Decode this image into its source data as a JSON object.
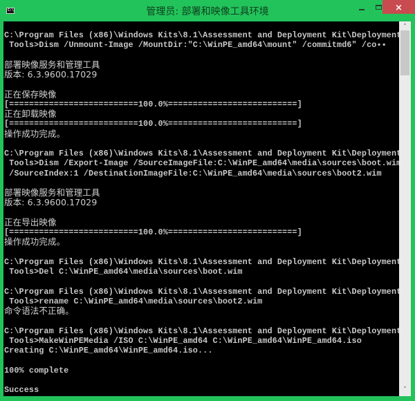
{
  "window": {
    "title": "管理员: 部署和映像工具环境",
    "app_icon_label": "C:\\",
    "controls": {
      "minimize": "minimize",
      "maximize": "maximize",
      "close": "×"
    },
    "accent_color": "#22c35a",
    "close_color": "#c84b4f"
  },
  "scrollbar": {
    "up_arrow": "˄",
    "down_arrow": "˅",
    "position_fraction": 0.0
  },
  "console": {
    "lines": [
      "C:\\Program Files (x86)\\Windows Kits\\8.1\\Assessment and Deployment Kit\\Deployment",
      " Tools>Dism /Unmount-Image /MountDir:\"C:\\WinPE_amd64\\mount\" /commitmd6\" /co▪▪",
      "",
      "部署映像服务和管理工具",
      "版本: 6.3.9600.17029",
      "",
      "正在保存映像",
      "[==========================100.0%==========================]",
      "正在卸载映像",
      "[==========================100.0%==========================]",
      "操作成功完成。",
      "",
      "C:\\Program Files (x86)\\Windows Kits\\8.1\\Assessment and Deployment Kit\\Deployment",
      " Tools>Dism /Export-Image /SourceImageFile:C:\\WinPE_amd64\\media\\sources\\boot.wim",
      " /SourceIndex:1 /DestinationImageFile:C:\\WinPE_amd64\\media\\sources\\boot2.wim",
      "",
      "部署映像服务和管理工具",
      "版本: 6.3.9600.17029",
      "",
      "正在导出映像",
      "[==========================100.0%==========================]",
      "操作成功完成。",
      "",
      "C:\\Program Files (x86)\\Windows Kits\\8.1\\Assessment and Deployment Kit\\Deployment",
      " Tools>Del C:\\WinPE_amd64\\media\\sources\\boot.wim",
      "",
      "C:\\Program Files (x86)\\Windows Kits\\8.1\\Assessment and Deployment Kit\\Deployment",
      " Tools>rename C:\\WinPE_amd64\\media\\sources\\boot2.wim",
      "命令语法不正确。",
      "",
      "C:\\Program Files (x86)\\Windows Kits\\8.1\\Assessment and Deployment Kit\\Deployment",
      " Tools>MakeWinPEMedia /ISO C:\\WinPE_amd64 C:\\WinPE_amd64\\WinPE_amd64.iso",
      "Creating C:\\WinPE_amd64\\WinPE_amd64.iso...",
      "",
      "100% complete",
      "",
      "Success"
    ]
  }
}
